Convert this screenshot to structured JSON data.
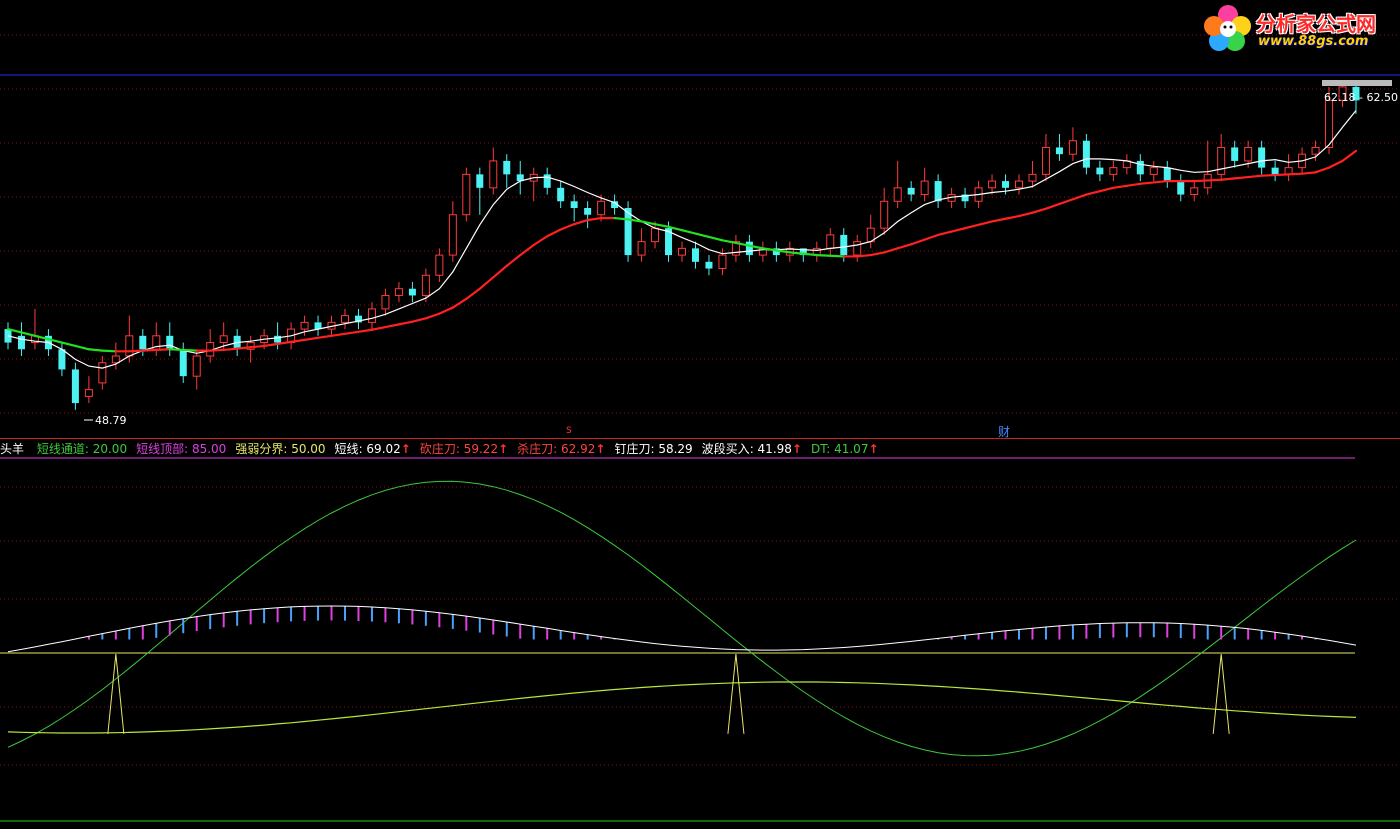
{
  "indicator": {
    "name": "头羊",
    "lines": [
      {
        "label": "短线通道",
        "value": "20.00",
        "color": "#3ec83e",
        "arrow": ""
      },
      {
        "label": "短线顶部",
        "value": "85.00",
        "color": "#e040e0",
        "arrow": ""
      },
      {
        "label": "强弱分界",
        "value": "50.00",
        "color": "#e8e86a",
        "arrow": ""
      },
      {
        "label": "短线",
        "value": "69.02",
        "color": "#ffffff",
        "arrow": "↑"
      },
      {
        "label": "砍庄刀",
        "value": "59.22",
        "color": "#ff4444",
        "arrow": "↑"
      },
      {
        "label": "杀庄刀",
        "value": "62.92",
        "color": "#ff4444",
        "arrow": "↑"
      },
      {
        "label": "钉庄刀",
        "value": "58.29",
        "color": "#ffffff",
        "arrow": ""
      },
      {
        "label": "波段买入",
        "value": "41.98",
        "color": "#ffffff",
        "arrow": "↑"
      },
      {
        "label": "DT",
        "value": "41.07",
        "color": "#3ec83e",
        "arrow": "↑"
      }
    ]
  },
  "logo": {
    "title": "分析家公式网",
    "url": "www.88gs.com"
  },
  "annotations": {
    "low_label": "48.79",
    "price_range": "62.18 - 62.50",
    "cai_marker": "财",
    "s_marker": "S"
  },
  "colors": {
    "up": "#ff3b3b",
    "down": "#4cf2f2",
    "ma_white": "#ffffff",
    "ma_red": "#ff2020",
    "ma_green": "#22e022",
    "grid": "#8a1010",
    "hline_blue": "#2d2dff",
    "bar_magenta": "#e040e0",
    "bar_blue": "#4aa0ff"
  },
  "chart_data": {
    "type": "candlestick",
    "candles": [
      [
        45,
        43,
        46,
        42
      ],
      [
        44,
        42,
        46,
        41
      ],
      [
        43,
        44,
        48,
        42
      ],
      [
        44,
        42,
        45,
        41
      ],
      [
        42,
        39,
        43,
        38
      ],
      [
        39,
        34,
        40,
        33
      ],
      [
        35,
        36,
        38,
        34
      ],
      [
        37,
        40,
        41,
        36
      ],
      [
        40,
        41,
        43,
        39
      ],
      [
        41,
        44,
        47,
        40
      ],
      [
        44,
        42,
        45,
        41
      ],
      [
        42,
        44,
        46,
        41
      ],
      [
        44,
        42,
        46,
        41
      ],
      [
        42,
        38,
        43,
        37
      ],
      [
        38,
        41,
        42,
        36
      ],
      [
        41,
        43,
        45,
        40
      ],
      [
        43,
        44,
        46,
        42
      ],
      [
        44,
        42,
        45,
        41
      ],
      [
        42,
        43,
        44,
        40
      ],
      [
        43,
        44,
        45,
        42
      ],
      [
        44,
        43,
        46,
        42
      ],
      [
        43,
        45,
        46,
        42
      ],
      [
        45,
        46,
        47,
        44
      ],
      [
        46,
        45,
        47,
        44
      ],
      [
        45,
        46,
        47,
        44
      ],
      [
        46,
        47,
        48,
        45
      ],
      [
        47,
        46,
        48,
        45
      ],
      [
        46,
        48,
        49,
        45
      ],
      [
        48,
        50,
        51,
        47
      ],
      [
        50,
        51,
        52,
        49
      ],
      [
        51,
        50,
        52,
        49
      ],
      [
        50,
        53,
        54,
        49
      ],
      [
        53,
        56,
        57,
        52
      ],
      [
        56,
        62,
        64,
        55
      ],
      [
        62,
        68,
        69,
        61
      ],
      [
        68,
        66,
        69,
        62
      ],
      [
        66,
        70,
        72,
        65
      ],
      [
        70,
        68,
        71,
        66
      ],
      [
        68,
        67,
        70,
        65
      ],
      [
        67,
        68,
        69,
        64
      ],
      [
        68,
        66,
        69,
        65
      ],
      [
        66,
        64,
        67,
        63
      ],
      [
        64,
        63,
        65,
        61
      ],
      [
        63,
        62,
        64,
        60
      ],
      [
        62,
        64,
        65,
        61
      ],
      [
        64,
        63,
        65,
        62
      ],
      [
        63,
        56,
        64,
        55
      ],
      [
        56,
        58,
        60,
        55
      ],
      [
        58,
        60,
        61,
        57
      ],
      [
        60,
        56,
        61,
        55
      ],
      [
        56,
        57,
        58,
        55
      ],
      [
        57,
        55,
        58,
        54
      ],
      [
        55,
        54,
        56,
        53
      ],
      [
        54,
        56,
        57,
        53
      ],
      [
        56,
        58,
        59,
        55
      ],
      [
        58,
        56,
        59,
        55
      ],
      [
        56,
        57,
        58,
        55
      ],
      [
        57,
        56,
        58,
        55
      ],
      [
        56,
        57,
        58,
        55
      ],
      [
        57,
        56,
        57,
        55
      ],
      [
        56,
        57,
        58,
        55
      ],
      [
        57,
        59,
        60,
        56
      ],
      [
        59,
        56,
        60,
        55
      ],
      [
        56,
        58,
        59,
        55
      ],
      [
        58,
        60,
        62,
        57
      ],
      [
        60,
        64,
        66,
        59
      ],
      [
        64,
        66,
        70,
        63
      ],
      [
        66,
        65,
        67,
        64
      ],
      [
        65,
        67,
        69,
        64
      ],
      [
        67,
        64,
        68,
        63
      ],
      [
        64,
        65,
        66,
        63
      ],
      [
        65,
        64,
        66,
        63
      ],
      [
        64,
        66,
        67,
        63
      ],
      [
        66,
        67,
        68,
        65
      ],
      [
        67,
        66,
        68,
        65
      ],
      [
        66,
        67,
        68,
        65
      ],
      [
        67,
        68,
        70,
        66
      ],
      [
        68,
        72,
        74,
        67
      ],
      [
        72,
        71,
        74,
        70
      ],
      [
        71,
        73,
        75,
        70
      ],
      [
        73,
        69,
        74,
        68
      ],
      [
        69,
        68,
        70,
        67
      ],
      [
        68,
        69,
        70,
        67
      ],
      [
        69,
        70,
        71,
        68
      ],
      [
        70,
        68,
        71,
        67
      ],
      [
        68,
        69,
        70,
        67
      ],
      [
        69,
        67,
        70,
        66
      ],
      [
        67,
        65,
        68,
        64
      ],
      [
        65,
        66,
        67,
        64
      ],
      [
        66,
        68,
        73,
        65
      ],
      [
        68,
        72,
        74,
        67
      ],
      [
        72,
        70,
        73,
        69
      ],
      [
        70,
        72,
        73,
        69
      ],
      [
        72,
        69,
        73,
        68
      ],
      [
        69,
        68,
        70,
        67
      ],
      [
        68,
        69,
        71,
        67
      ],
      [
        69,
        71,
        72,
        68
      ],
      [
        71,
        72,
        73,
        70
      ],
      [
        72,
        79,
        81,
        71
      ],
      [
        79,
        81,
        82,
        78
      ],
      [
        81,
        79,
        82,
        77
      ]
    ],
    "ma_fast": [
      44,
      43.5,
      43.2,
      43,
      42,
      40.5,
      39.5,
      39.2,
      39.8,
      41,
      41.8,
      42.4,
      42.6,
      41.8,
      41.4,
      41.8,
      42.5,
      43,
      43.2,
      43.5,
      43.7,
      44,
      44.6,
      45,
      45.4,
      45.8,
      46.2,
      46.6,
      47.2,
      48,
      48.8,
      49.6,
      51,
      53.5,
      57,
      60.5,
      63.5,
      65.8,
      67,
      67.5,
      67.6,
      67,
      66.2,
      65.3,
      64.5,
      63.8,
      62.3,
      61,
      60,
      59.5,
      58.6,
      57.8,
      56.8,
      56.2,
      56.4,
      56.6,
      56.8,
      56.8,
      56.9,
      56.8,
      56.7,
      57,
      57.2,
      57.5,
      58,
      59.3,
      61,
      62.3,
      63.5,
      64.2,
      64.6,
      64.8,
      65,
      65.3,
      65.5,
      65.8,
      66.2,
      67.3,
      68.4,
      69.6,
      70.3,
      70.3,
      70.2,
      70,
      69.5,
      69.2,
      69,
      68.6,
      68.3,
      68.4,
      68.8,
      69.2,
      69.6,
      70,
      70.2,
      69.8,
      70,
      70.6,
      72.4,
      75,
      77.5
    ],
    "ma_slow": [
      45,
      44.5,
      44,
      43.5,
      43,
      42.5,
      42,
      41.8,
      41.7,
      41.7,
      41.8,
      41.9,
      42,
      41.9,
      41.8,
      41.8,
      41.9,
      42.1,
      42.3,
      42.5,
      42.8,
      43.1,
      43.4,
      43.7,
      44,
      44.3,
      44.6,
      44.9,
      45.3,
      45.7,
      46.1,
      46.6,
      47.3,
      48.2,
      49.5,
      51,
      52.7,
      54.4,
      56,
      57.5,
      58.8,
      59.8,
      60.6,
      61.2,
      61.5,
      61.5,
      61.3,
      61,
      60.6,
      60.2,
      59.7,
      59.2,
      58.7,
      58.2,
      57.8,
      57.4,
      57,
      56.7,
      56.4,
      56.2,
      56,
      55.9,
      55.8,
      55.8,
      56,
      56.4,
      57,
      57.6,
      58.3,
      59,
      59.5,
      60,
      60.5,
      61,
      61.4,
      61.8,
      62.3,
      62.9,
      63.6,
      64.3,
      65,
      65.5,
      66,
      66.3,
      66.6,
      66.8,
      67,
      67,
      67,
      67.1,
      67.2,
      67.4,
      67.6,
      67.8,
      67.9,
      68,
      68.1,
      68.3,
      69,
      70,
      71.5
    ]
  }
}
